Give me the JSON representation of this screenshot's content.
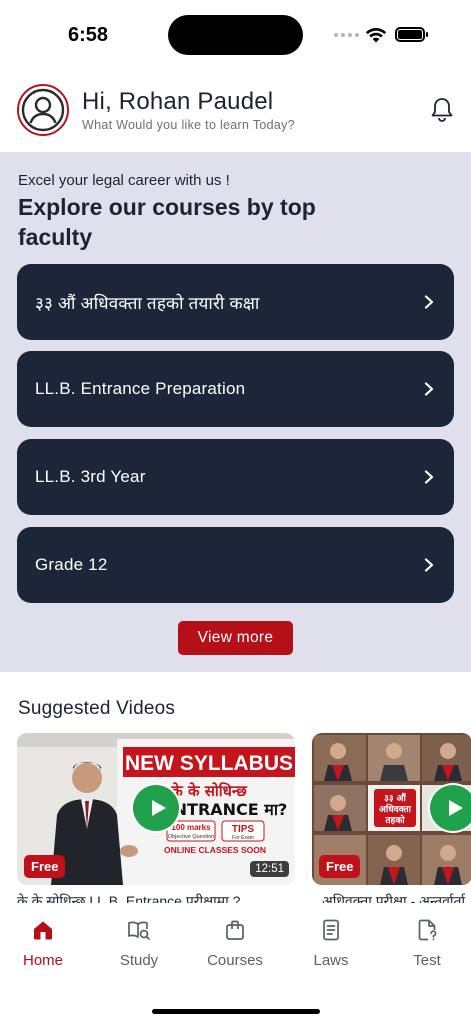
{
  "status_bar": {
    "time": "6:58"
  },
  "header": {
    "greeting": "Hi, Rohan Paudel",
    "subtitle": "What Would you like to learn Today?"
  },
  "hero": {
    "tagline": "Excel your legal career with us !",
    "title": "Explore our courses by top faculty",
    "courses": [
      {
        "label": "३३ औं अधिवक्ता तहको तयारी कक्षा"
      },
      {
        "label": "LL.B. Entrance Preparation"
      },
      {
        "label": "LL.B. 3rd Year"
      },
      {
        "label": "Grade 12"
      }
    ],
    "view_more": "View more"
  },
  "suggested": {
    "title": "Suggested Videos",
    "videos": [
      {
        "badge": "Free",
        "duration": "12:51",
        "caption": "के के सोधिन्छ LL.B. Entrance परीक्षामा ?",
        "thumb_text": {
          "banner": "NEW SYLLABUS",
          "line1": "के के सोधिन्छ",
          "line2": "ENTRANCE मा?",
          "marks": "100 marks",
          "marks_sub": "Objective Question",
          "tips": "TIPS",
          "tips_sub": "For Exam",
          "soon": "ONLINE CLASSES SOON"
        }
      },
      {
        "badge": "Free",
        "duration": "",
        "caption": "अधिवक्ता परीक्षा - अन्तर्वार्ता",
        "thumb_text": {
          "line1": "३३ औं",
          "line2": "अधिवक्ता",
          "line3": "तहको"
        }
      }
    ]
  },
  "tabs": [
    {
      "label": "Home",
      "icon": "home-icon",
      "active": true
    },
    {
      "label": "Study",
      "icon": "study-icon",
      "active": false
    },
    {
      "label": "Courses",
      "icon": "courses-icon",
      "active": false
    },
    {
      "label": "Laws",
      "icon": "laws-icon",
      "active": false
    },
    {
      "label": "Test",
      "icon": "test-icon",
      "active": false
    }
  ],
  "colors": {
    "accent": "#b50f17",
    "navy": "#1d2539",
    "hero_bg": "#dfe0ec",
    "play": "#21a14b"
  }
}
